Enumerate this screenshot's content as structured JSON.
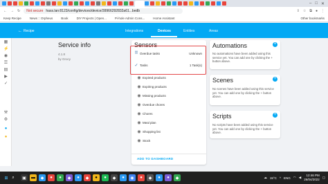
{
  "browser": {
    "url_security": "Not secure",
    "url": "hass.lan:8123/config/devices/device/39966292832a61...bedb",
    "bookmarks": [
      "Keep Recipe",
      "News :: Orpheus",
      "Book",
      "DIY Projects | Open...",
      "Pi-hole Admin Cons...",
      "Home Assistant"
    ],
    "other_bookmarks": "Other bookmarks"
  },
  "ha": {
    "back_label": "←",
    "device_title": "Recipe",
    "tabs": [
      "Integrations",
      "Devices",
      "Entities",
      "Areas"
    ],
    "active_tab": "Devices"
  },
  "service_info": {
    "title": "Service info",
    "version": "4.1.8",
    "by": "by Grocy"
  },
  "sensors": {
    "title": "Sensors",
    "highlighted": [
      {
        "label": "Overdue tasks",
        "value": "Unknown",
        "icon": "exclamation-icon"
      },
      {
        "label": "Tasks",
        "value": "1 Task(s)",
        "icon": "check-circle-icon"
      }
    ],
    "items": [
      {
        "label": "Expired products",
        "icon": "eye-icon"
      },
      {
        "label": "Expiring products",
        "icon": "eye-icon"
      },
      {
        "label": "Missing products",
        "icon": "eye-icon"
      },
      {
        "label": "Overdue chores",
        "icon": "eye-icon"
      },
      {
        "label": "Chores",
        "icon": "eye-icon"
      },
      {
        "label": "Meal plan",
        "icon": "eye-icon"
      },
      {
        "label": "Shopping list",
        "icon": "eye-icon"
      },
      {
        "label": "Stock",
        "icon": "eye-icon"
      }
    ],
    "add_to_dashboard": "ADD TO DASHBOARD"
  },
  "automations": {
    "title": "Automations",
    "text": "No automations have been added using this service yet. You can add one by clicking the + button above."
  },
  "scenes": {
    "title": "Scenes",
    "text": "No scenes have been added using this service yet. You can add one by clicking the + button above."
  },
  "scripts": {
    "title": "Scripts",
    "text": "No scripts have been added using this service yet. You can add one by clicking the + button above."
  },
  "taskbar": {
    "temperature": "15°C",
    "time": "12:46 PM",
    "date": "26/04/2022",
    "language": "ENG"
  },
  "colors": {
    "primary": "#03a9f4",
    "highlight_box": "#e34849",
    "taskbar": "#202020"
  }
}
